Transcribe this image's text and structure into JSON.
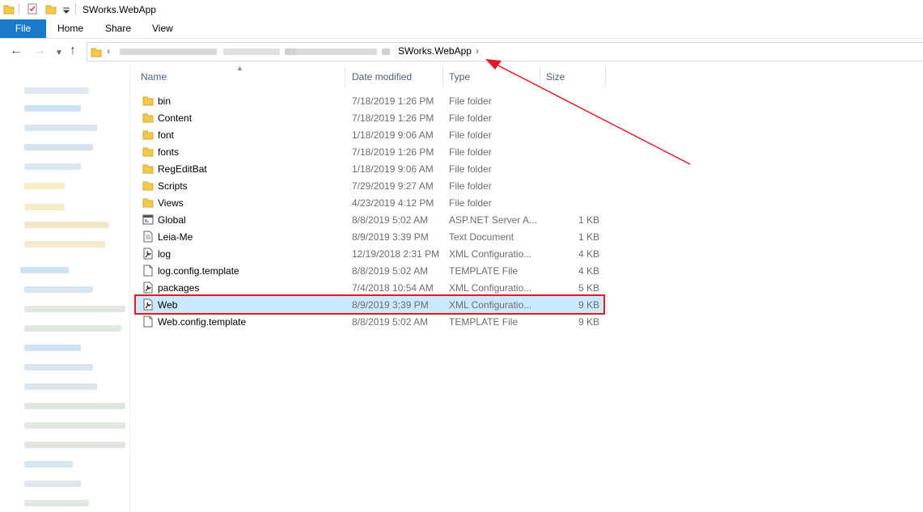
{
  "window": {
    "title": "SWorks.WebApp"
  },
  "ribbon": {
    "file": "File",
    "tabs": [
      "Home",
      "Share",
      "View"
    ]
  },
  "address": {
    "current_folder": "SWorks.WebApp"
  },
  "columns": {
    "name": "Name",
    "date": "Date modified",
    "type": "Type",
    "size": "Size"
  },
  "files": [
    {
      "name": "bin",
      "date": "7/18/2019 1:26 PM",
      "type": "File folder",
      "size": "",
      "icon": "folder-icon"
    },
    {
      "name": "Content",
      "date": "7/18/2019 1:26 PM",
      "type": "File folder",
      "size": "",
      "icon": "folder-icon"
    },
    {
      "name": "font",
      "date": "1/18/2019 9:06 AM",
      "type": "File folder",
      "size": "",
      "icon": "folder-icon"
    },
    {
      "name": "fonts",
      "date": "7/18/2019 1:26 PM",
      "type": "File folder",
      "size": "",
      "icon": "folder-icon"
    },
    {
      "name": "RegEditBat",
      "date": "1/18/2019 9:06 AM",
      "type": "File folder",
      "size": "",
      "icon": "folder-icon"
    },
    {
      "name": "Scripts",
      "date": "7/29/2019 9:27 AM",
      "type": "File folder",
      "size": "",
      "icon": "folder-icon"
    },
    {
      "name": "Views",
      "date": "4/23/2019 4:12 PM",
      "type": "File folder",
      "size": "",
      "icon": "folder-icon"
    },
    {
      "name": "Global",
      "date": "8/8/2019 5:02 AM",
      "type": "ASP.NET Server A...",
      "size": "1 KB",
      "icon": "aspx-file-icon"
    },
    {
      "name": "Leia-Me",
      "date": "8/9/2019 3:39 PM",
      "type": "Text Document",
      "size": "1 KB",
      "icon": "text-file-icon"
    },
    {
      "name": "log",
      "date": "12/19/2018 2:31 PM",
      "type": "XML Configuratio...",
      "size": "4 KB",
      "icon": "config-file-icon"
    },
    {
      "name": "log.config.template",
      "date": "8/8/2019 5:02 AM",
      "type": "TEMPLATE File",
      "size": "4 KB",
      "icon": "blank-file-icon"
    },
    {
      "name": "packages",
      "date": "7/4/2018 10:54 AM",
      "type": "XML Configuratio...",
      "size": "5 KB",
      "icon": "config-file-icon"
    },
    {
      "name": "Web",
      "date": "8/9/2019 3:39 PM",
      "type": "XML Configuratio...",
      "size": "9 KB",
      "icon": "config-file-icon",
      "selected": true
    },
    {
      "name": "Web.config.template",
      "date": "8/8/2019 5:02 AM",
      "type": "TEMPLATE File",
      "size": "9 KB",
      "icon": "blank-file-icon"
    }
  ],
  "colors": {
    "accent": "#1979ca",
    "selection": "#cce8ff",
    "highlight_box": "#e01b24",
    "annotation_arrow": "#e01b24"
  }
}
